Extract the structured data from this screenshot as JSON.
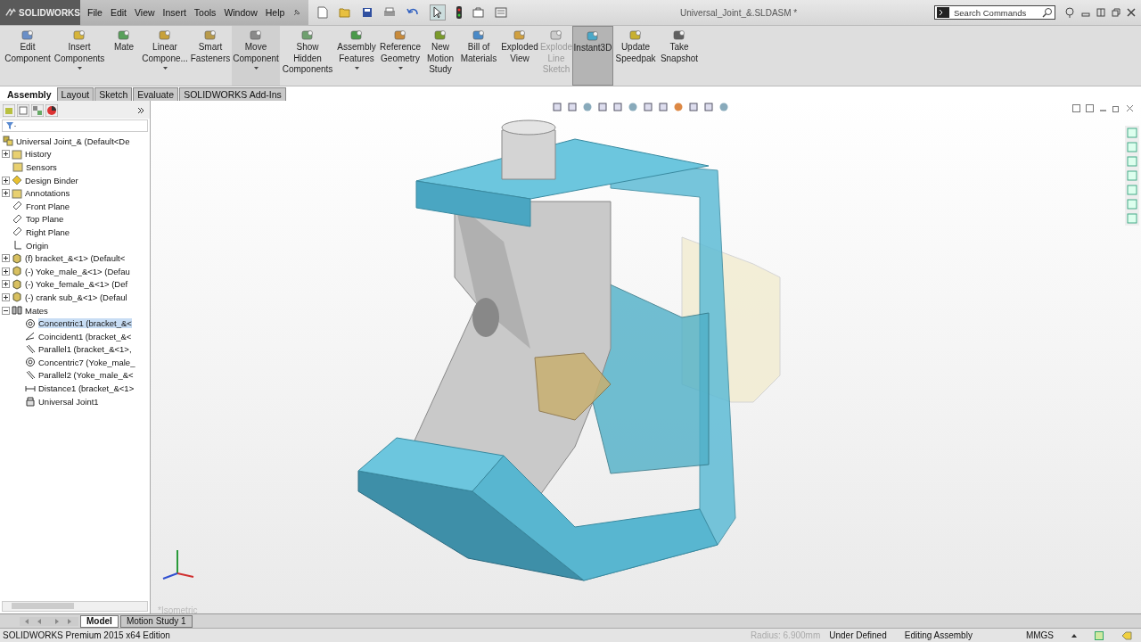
{
  "app": {
    "logo": "SOLIDWORKS",
    "menu": [
      "File",
      "Edit",
      "View",
      "Insert",
      "Tools",
      "Window",
      "Help"
    ],
    "title": "Universal_Joint_&.SLDASM *",
    "search": {
      "placeholder": "Search Commands"
    }
  },
  "ribbon": [
    {
      "label": "Edit Component",
      "dropdown": false,
      "disabled": false,
      "on": false
    },
    {
      "label": "Insert Components",
      "dropdown": true,
      "disabled": false,
      "on": false
    },
    {
      "label": "Mate",
      "dropdown": false,
      "disabled": false,
      "on": false
    },
    {
      "label": "Linear Compone...",
      "dropdown": true,
      "disabled": false,
      "on": false
    },
    {
      "label": "Smart Fasteners",
      "dropdown": false,
      "disabled": false,
      "on": false
    },
    {
      "label": "Move Component",
      "dropdown": true,
      "disabled": false,
      "on": false
    },
    {
      "label": "Show Hidden Components",
      "dropdown": false,
      "disabled": false,
      "on": false
    },
    {
      "label": "Assembly Features",
      "dropdown": true,
      "disabled": false,
      "on": false
    },
    {
      "label": "Reference Geometry",
      "dropdown": true,
      "disabled": false,
      "on": false
    },
    {
      "label": "New Motion Study",
      "dropdown": false,
      "disabled": false,
      "on": false
    },
    {
      "label": "Bill of Materials",
      "dropdown": false,
      "disabled": false,
      "on": false
    },
    {
      "label": "Exploded View",
      "dropdown": false,
      "disabled": false,
      "on": false
    },
    {
      "label": "Explode Line Sketch",
      "dropdown": false,
      "disabled": true,
      "on": false
    },
    {
      "label": "Instant3D",
      "dropdown": false,
      "disabled": false,
      "on": true
    },
    {
      "label": "Update Speedpak",
      "dropdown": false,
      "disabled": false,
      "on": false
    },
    {
      "label": "Take Snapshot",
      "dropdown": false,
      "disabled": false,
      "on": false
    }
  ],
  "tabs": [
    {
      "label": "Assembly",
      "selected": true
    },
    {
      "label": "Layout",
      "selected": false
    },
    {
      "label": "Sketch",
      "selected": false
    },
    {
      "label": "Evaluate",
      "selected": false
    },
    {
      "label": "SOLIDWORKS Add-Ins",
      "selected": false
    }
  ],
  "tree": {
    "root": "Universal Joint_&  (Default<De",
    "items": [
      {
        "label": "History",
        "kind": "folder",
        "expanded": false,
        "selected": false
      },
      {
        "label": "Sensors",
        "kind": "folder",
        "selected": false
      },
      {
        "label": "Design Binder",
        "kind": "binder",
        "expanded": false,
        "selected": false
      },
      {
        "label": "Annotations",
        "kind": "folder",
        "expanded": false,
        "selected": false
      },
      {
        "label": "Front Plane",
        "kind": "plane",
        "selected": false
      },
      {
        "label": "Top Plane",
        "kind": "plane",
        "selected": false
      },
      {
        "label": "Right Plane",
        "kind": "plane",
        "selected": false
      },
      {
        "label": "Origin",
        "kind": "origin",
        "selected": false
      },
      {
        "label": "(f) bracket_&<1> (Default<",
        "kind": "part",
        "expanded": false,
        "selected": false
      },
      {
        "label": "(-) Yoke_male_&<1> (Defau",
        "kind": "part",
        "expanded": false,
        "selected": false
      },
      {
        "label": "(-) Yoke_female_&<1> (Def",
        "kind": "part",
        "expanded": false,
        "selected": false
      },
      {
        "label": "(-) crank sub_&<1> (Defaul",
        "kind": "subassembly",
        "expanded": false,
        "selected": false
      },
      {
        "label": "Mates",
        "kind": "mates",
        "expanded": true,
        "selected": false,
        "children": [
          {
            "label": "Concentric1 (bracket_&<",
            "kind": "concentric",
            "selected": true
          },
          {
            "label": "Coincident1 (bracket_&<",
            "kind": "coincident",
            "selected": false
          },
          {
            "label": "Parallel1 (bracket_&<1>,",
            "kind": "parallel",
            "selected": false
          },
          {
            "label": "Concentric7 (Yoke_male_",
            "kind": "concentric",
            "selected": false
          },
          {
            "label": "Parallel2 (Yoke_male_&<",
            "kind": "parallel",
            "selected": false
          },
          {
            "label": "Distance1 (bracket_&<1>",
            "kind": "distance",
            "selected": false
          },
          {
            "label": "Universal Joint1",
            "kind": "joint",
            "selected": false
          }
        ]
      }
    ]
  },
  "viewport": {
    "view_label": "*Isometric"
  },
  "bottom_tabs": [
    {
      "label": "Model",
      "selected": true
    },
    {
      "label": "Motion Study 1",
      "selected": false
    }
  ],
  "status_bar": {
    "edition": "SOLIDWORKS Premium 2015 x64 Edition",
    "radius": "Radius: 6.900mm",
    "state": "Under Defined",
    "mode": "Editing Assembly",
    "units": "MMGS"
  }
}
